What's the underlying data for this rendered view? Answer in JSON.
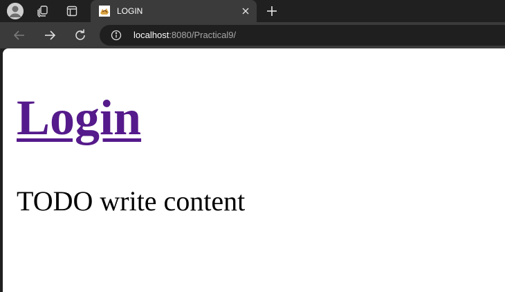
{
  "tab": {
    "title": "LOGIN"
  },
  "address_bar": {
    "host": "localhost",
    "rest": ":8080/Practical9/"
  },
  "page": {
    "heading": "Login",
    "body": "TODO write content"
  },
  "colors": {
    "link_visited": "#551a8b",
    "chrome_dark": "#202020",
    "toolbar": "#3b3b3b"
  }
}
